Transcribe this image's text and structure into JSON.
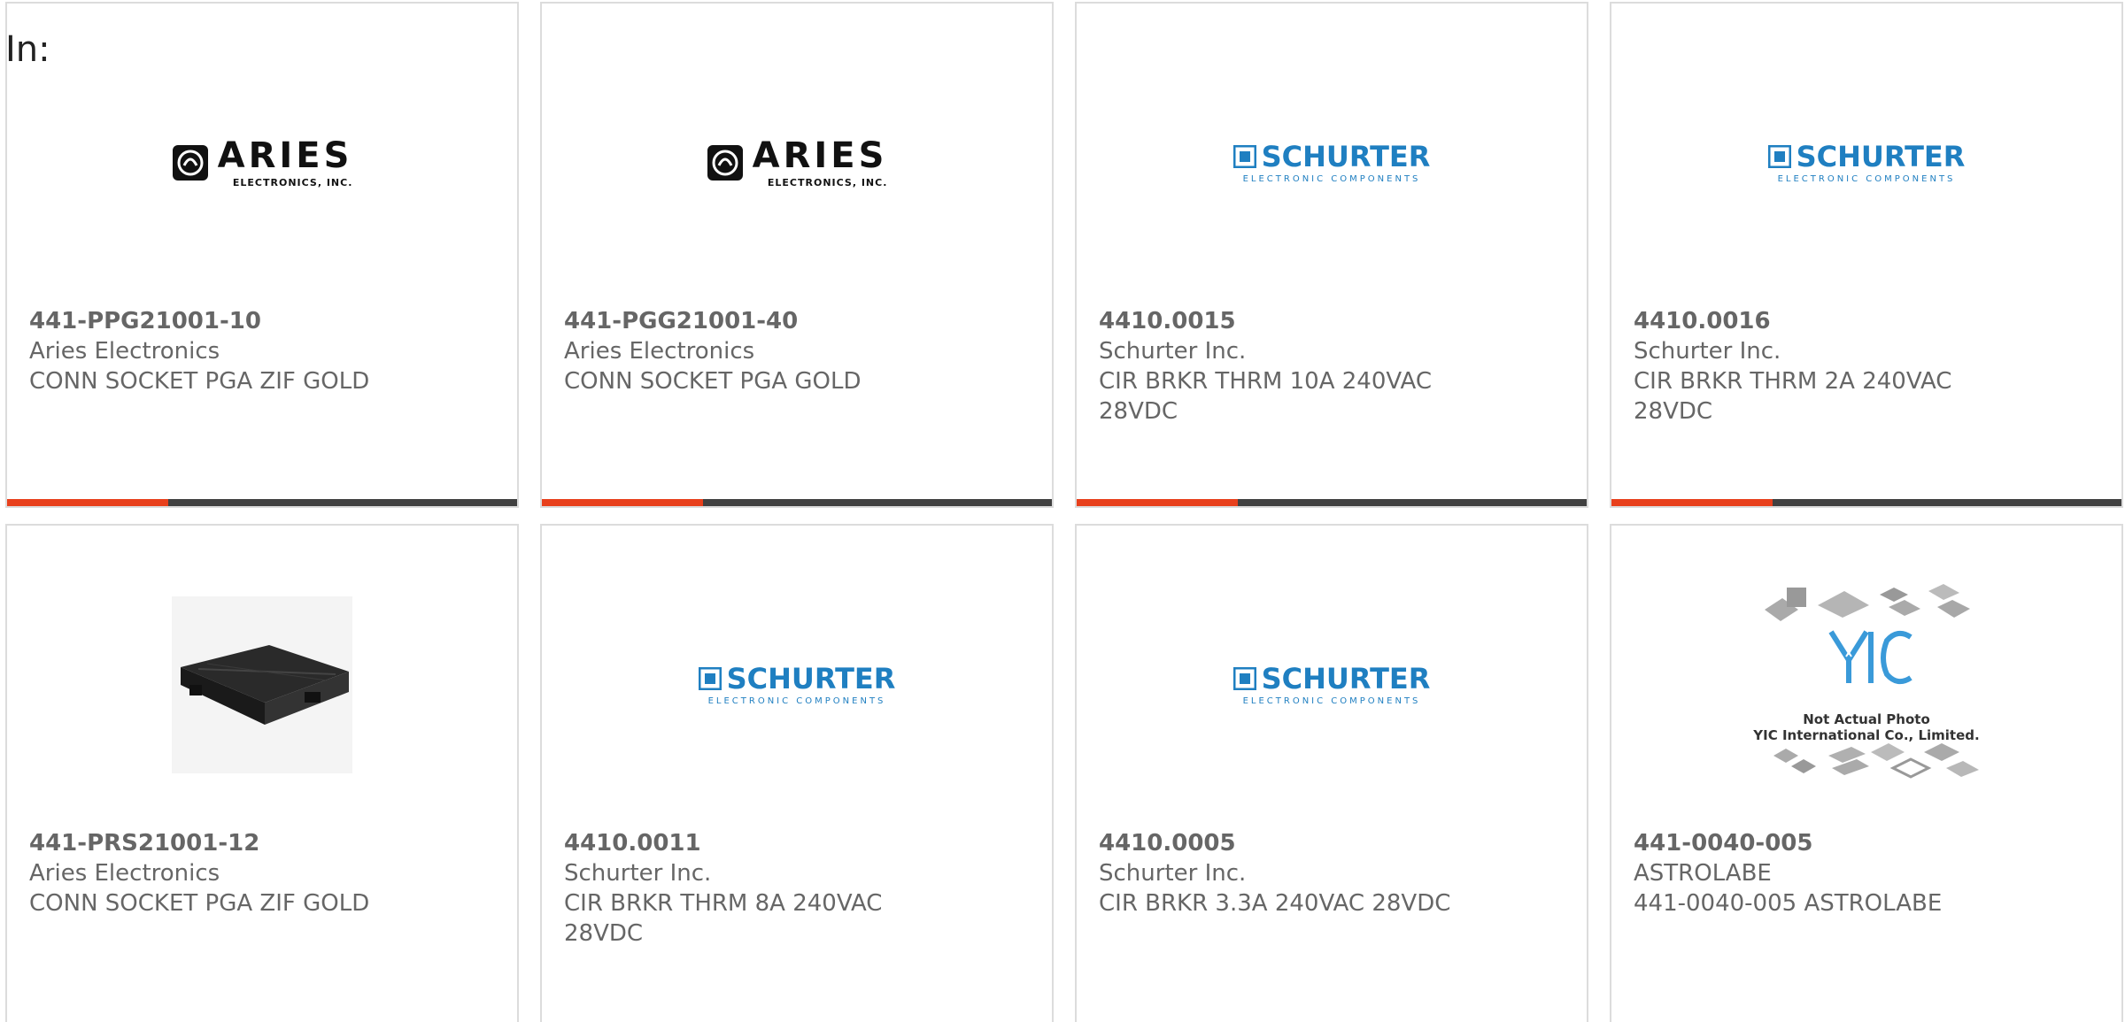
{
  "header": {
    "in_label": "In:"
  },
  "colors": {
    "accent_bar": "#e8401c",
    "bar_base": "#414141",
    "schurter_blue": "#1f7fc1",
    "text_gray": "#666666",
    "card_border": "#dcdcdc"
  },
  "products": [
    {
      "part_number": "441-PPG21001-10",
      "manufacturer": "Aries Electronics",
      "description": "CONN SOCKET PGA ZIF GOLD",
      "image": "aries-logo",
      "logo_text": "ARIES",
      "logo_sub": "ELECTRONICS, INC."
    },
    {
      "part_number": "441-PGG21001-40",
      "manufacturer": "Aries Electronics",
      "description": "CONN SOCKET PGA GOLD",
      "image": "aries-logo",
      "logo_text": "ARIES",
      "logo_sub": "ELECTRONICS, INC."
    },
    {
      "part_number": "4410.0015",
      "manufacturer": "Schurter Inc.",
      "description": "CIR BRKR THRM 10A 240VAC 28VDC",
      "image": "schurter-logo",
      "logo_text": "SCHURTER",
      "logo_sub": "ELECTRONIC COMPONENTS"
    },
    {
      "part_number": "4410.0016",
      "manufacturer": "Schurter Inc.",
      "description": "CIR BRKR THRM 2A 240VAC 28VDC",
      "image": "schurter-logo",
      "logo_text": "SCHURTER",
      "logo_sub": "ELECTRONIC COMPONENTS"
    },
    {
      "part_number": "441-PRS21001-12",
      "manufacturer": "Aries Electronics",
      "description": "CONN SOCKET PGA ZIF GOLD",
      "image": "socket-photo"
    },
    {
      "part_number": "4410.0011",
      "manufacturer": "Schurter Inc.",
      "description": "CIR BRKR THRM 8A 240VAC 28VDC",
      "image": "schurter-logo",
      "logo_text": "SCHURTER",
      "logo_sub": "ELECTRONIC COMPONENTS"
    },
    {
      "part_number": "4410.0005",
      "manufacturer": "Schurter Inc.",
      "description": "CIR BRKR 3.3A 240VAC 28VDC",
      "image": "schurter-logo",
      "logo_text": "SCHURTER",
      "logo_sub": "ELECTRONIC COMPONENTS"
    },
    {
      "part_number": "441-0040-005",
      "manufacturer": "ASTROLABE",
      "description": "441-0040-005 ASTROLABE",
      "image": "yic-placeholder",
      "logo_text": "YIC",
      "caption_line1": "Not Actual Photo",
      "caption_line2": "YIC International Co., Limited."
    }
  ]
}
